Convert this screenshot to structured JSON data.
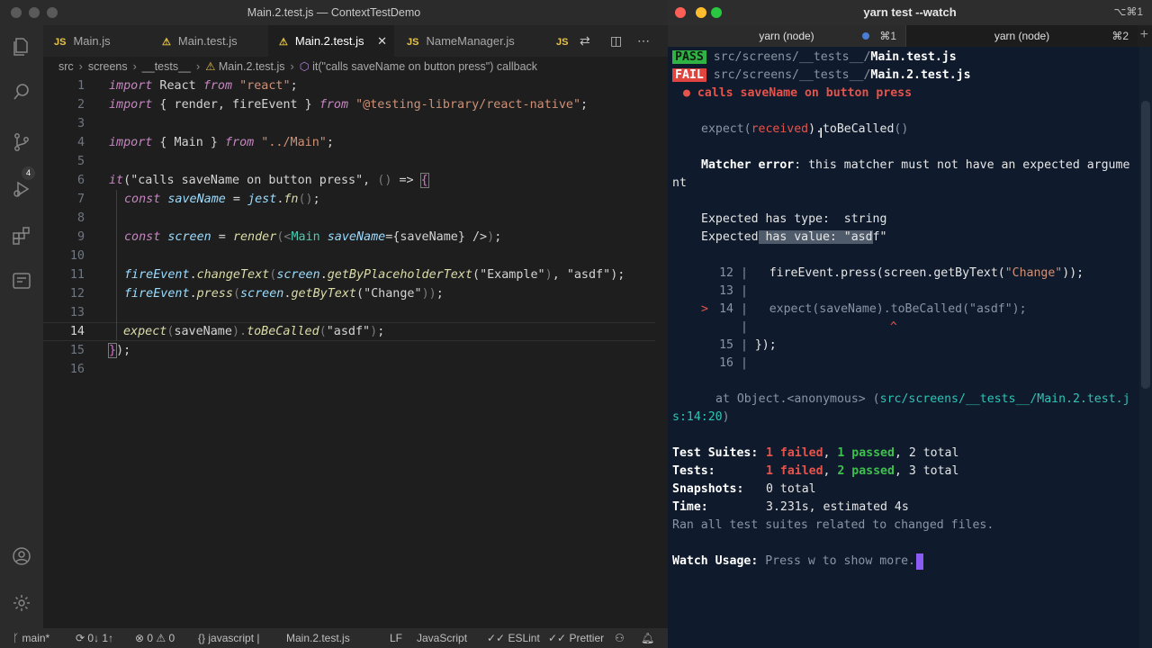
{
  "vscode": {
    "window_title": "Main.2.test.js — ContextTestDemo",
    "activity": {
      "scm_badge": "4"
    },
    "tabs": [
      {
        "badge": "JS",
        "label": "Main.js"
      },
      {
        "badge": "",
        "label": "Main.test.js"
      },
      {
        "badge": "",
        "label": "Main.2.test.js",
        "close": "✕"
      },
      {
        "badge": "JS",
        "label": "NameManager.js"
      },
      {
        "badge": "JS",
        "label": ""
      }
    ],
    "breadcrumb": [
      "src",
      "screens",
      "__tests__",
      "Main.2.test.js",
      "it(\"calls saveName on button press\") callback"
    ],
    "editor": {
      "current_line": 14,
      "line_numbers": [
        "1",
        "2",
        "3",
        "4",
        "5",
        "6",
        "7",
        "8",
        "9",
        "10",
        "11",
        "12",
        "13",
        "14",
        "15",
        "16"
      ],
      "code": {
        "l1": {
          "a": "import",
          "b": " React ",
          "c": "from",
          "d": " \"react\"",
          "e": ";"
        },
        "l2": {
          "a": "import",
          "b": " { render, fireEvent } ",
          "c": "from",
          "d": " \"@testing-library/react-native\"",
          "e": ";"
        },
        "l4": {
          "a": "import",
          "b": " { Main } ",
          "c": "from",
          "d": " \"../Main\"",
          "e": ";"
        },
        "l6": {
          "a": "it",
          "b": "(",
          "c": "\"calls saveName on button press\"",
          "d": ", ",
          "e": "()",
          "f": " => ",
          "g": "{"
        },
        "l7": {
          "a": "const",
          "b": " saveName",
          "c": " = ",
          "d": "jest",
          "e": ".",
          "f": "fn",
          "g": "()",
          "h": ";"
        },
        "l9": {
          "a": "const",
          "b": " screen",
          "c": " = ",
          "d": "render",
          "e": "(",
          "f": "<",
          "g": "Main",
          "h": " saveName",
          "i": "={",
          "j": "saveName",
          "k": "} />",
          "l": ")",
          "m": ";"
        },
        "l11": {
          "a": "fireEvent",
          "b": ".",
          "c": "changeText",
          "d": "(",
          "e": "screen",
          "f": ".",
          "g": "getByPlaceholderText",
          "h": "(",
          "i": "\"Example\"",
          "j": ")",
          "k": ", ",
          "l": "\"asdf\"",
          "m": ");"
        },
        "l12": {
          "a": "fireEvent",
          "b": ".",
          "c": "press",
          "d": "(",
          "e": "screen",
          "f": ".",
          "g": "getByText",
          "h": "(",
          "i": "\"Change\"",
          "j": "))",
          "k": ";"
        },
        "l14": {
          "a": "expect",
          "b": "(",
          "c": "saveName",
          "d": ").",
          "e": "toBeCalled",
          "f": "(",
          "g": "\"asdf\"",
          "h": ")",
          "i": ";"
        },
        "l15": {
          "a": "}",
          "b": ");"
        }
      }
    },
    "status": {
      "branch": "main*",
      "sync": "0↓ 1↑",
      "problems": "0",
      "warnings": "0",
      "language_mode": "javascript",
      "file": "Main.2.test.js",
      "eol": "LF",
      "language": "JavaScript",
      "eslint": "ESLint",
      "prettier": "Prettier"
    }
  },
  "terminal": {
    "title": "yarn test --watch",
    "shortcut": "⌥⌘1",
    "tabs": [
      {
        "name": "yarn (node)",
        "key": "⌘1"
      },
      {
        "name": "yarn (node)",
        "key": "⌘2"
      }
    ],
    "add_tab": "+",
    "results": [
      {
        "status": "PASS",
        "path": "src/screens/__tests__/",
        "file": "Main.test.js"
      },
      {
        "status": "FAIL",
        "path": "src/screens/__tests__/",
        "file": "Main.2.test.js"
      }
    ],
    "failing_test": "● calls saveName on button press",
    "expect_line": {
      "a": "expect(",
      "b": "received",
      "c": ").toBeCalled",
      "d": "()"
    },
    "matcher_error": {
      "label": "Matcher error",
      "text": ": this matcher must not have an expected argume",
      "wrap": "nt"
    },
    "expected_type": "Expected has type:  string",
    "expected_value": {
      "a": "Expected",
      "b": " has value: \"asd",
      "c": "f\""
    },
    "snippet": [
      {
        "marker": "",
        "num": "12",
        "code_a": "fireEvent.press(screen.getByText(",
        "code_b": "\"Change\"",
        "code_c": "));"
      },
      {
        "marker": "",
        "num": "13",
        "code_a": "",
        "code_b": "",
        "code_c": ""
      },
      {
        "marker": ">",
        "num": "14",
        "code_a": "expect(saveName).toBeCalled(",
        "code_b": "\"asdf\"",
        "code_c": ");"
      },
      {
        "marker": "",
        "num": "",
        "code_a": "",
        "code_b": "^",
        "code_c": ""
      },
      {
        "marker": "",
        "num": "15",
        "code_a": "});",
        "code_b": "",
        "code_c": ""
      },
      {
        "marker": "",
        "num": "16",
        "code_a": "",
        "code_b": "",
        "code_c": ""
      }
    ],
    "at_line": {
      "a": "at Object.<anonymous> (",
      "b": "src/screens/__tests__/Main.2.test.j",
      "c": "s:14:20",
      "d": ")"
    },
    "summary": {
      "suites_label": "Test Suites:",
      "suites_failed": "1 failed",
      "suites_passed": "1 passed",
      "suites_total": "2 total",
      "tests_label": "Tests:",
      "tests_failed": "1 failed",
      "tests_passed": "2 passed",
      "tests_total": "3 total",
      "snapshots_label": "Snapshots:",
      "snapshots_value": "0 total",
      "time_label": "Time:",
      "time_value": "3.231s, estimated 4s",
      "ran": "Ran all test suites related to changed files."
    },
    "watch": {
      "label": "Watch Usage:",
      "text": " Press w to show more."
    }
  }
}
